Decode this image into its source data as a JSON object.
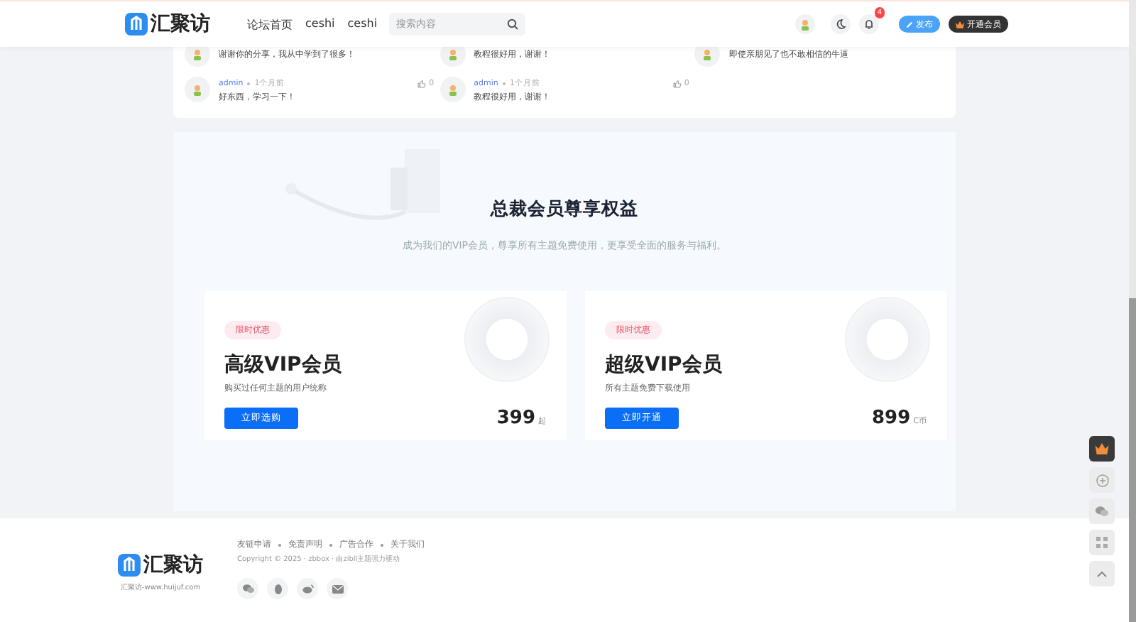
{
  "header": {
    "logo_text": "汇聚访",
    "nav": [
      {
        "label": "论坛首页",
        "selected": false
      },
      {
        "label": "ceshi",
        "selected": false
      },
      {
        "label": "ceshi",
        "selected": false
      }
    ],
    "search": {
      "placeholder": "搜索内容"
    },
    "notification_count": "4",
    "publish_button": "发布",
    "vip_button": "开通会员"
  },
  "comments": {
    "columns": [
      {
        "items": [
          {
            "text": "谢谢你的分享，我从中学到了很多！"
          },
          {
            "author": "admin",
            "time": "1个月前",
            "likes": "0",
            "text": "好东西，学习一下！"
          }
        ]
      },
      {
        "items": [
          {
            "text": "教程很好用，谢谢！"
          },
          {
            "author": "admin",
            "time": "1个月前",
            "likes": "0",
            "text": "教程很好用，谢谢！"
          }
        ]
      },
      {
        "items": [
          {
            "text": "即使亲朋见了也不敢相信的牛逼"
          }
        ]
      }
    ]
  },
  "vip": {
    "title": "总裁会员尊享权益",
    "subtitle": "成为我们的VIP会员，尊享所有主题免费使用，更享受全面的服务与福利。",
    "plans": [
      {
        "tag": "限时优惠",
        "name": "高级VIP会员",
        "desc": "购买过任何主题的用户统称",
        "button": "立即选购",
        "price": "399",
        "unit": "起"
      },
      {
        "tag": "限时优惠",
        "name": "超级VIP会员",
        "desc": "所有主题免费下载使用",
        "button": "立即开通",
        "price": "899",
        "unit": "C币"
      }
    ]
  },
  "footer": {
    "logo_text": "汇聚访",
    "site": "汇聚访-www.huijuf.com",
    "links": [
      "友链申请",
      "免责声明",
      "广告合作",
      "关于我们"
    ],
    "copyright": "Copyright © 2025 · zbbox · 由zibll主题强力驱动"
  }
}
